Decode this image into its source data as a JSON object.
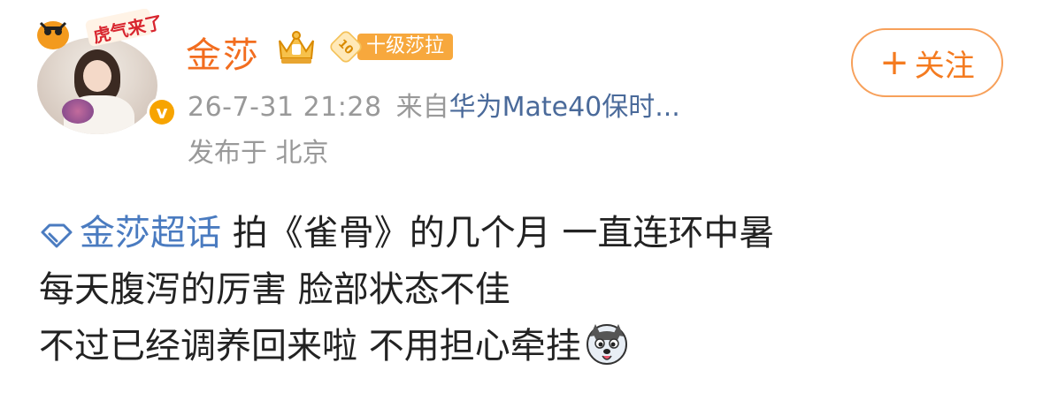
{
  "post": {
    "avatar_badge_text": "虎气来了",
    "user": {
      "name": "金莎",
      "level_number": "10",
      "level_label": "十级莎拉"
    },
    "follow_label": "关注",
    "time": "26-7-31 21:28",
    "source_prefix": "来自",
    "source_device": "华为Mate40保时...",
    "location": "发布于 北京",
    "topic": "金莎超话",
    "text_line1": "拍《雀骨》的几个月 一直连环中暑",
    "text_line2": "每天腹泻的厉害 脸部状态不佳",
    "text_line3": "不过已经调养回来啦 不用担心牵挂"
  },
  "colors": {
    "username": "#f26d1f",
    "follow_button": "#f47b20",
    "topic": "#4a7bc0",
    "meta": "#999999",
    "level_badge": "#f7a83d"
  },
  "icons": {
    "verified": "verified-icon",
    "vip": "vip-crown-icon",
    "topic": "topic-diamond-icon",
    "emoji": "husky-emoji-icon"
  }
}
